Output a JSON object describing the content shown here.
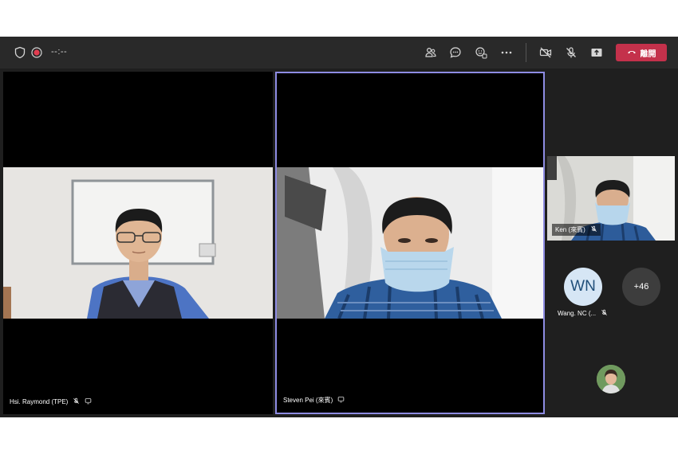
{
  "toolbar": {
    "timer": "--:--",
    "leave_label": "離開",
    "icons": {
      "shield": "shield-icon",
      "record": "record-icon",
      "people": "people-icon",
      "chat": "chat-icon",
      "reactions": "reactions-icon",
      "more": "more-options-icon",
      "camera": "camera-off-icon",
      "mic": "mic-off-icon",
      "share": "share-screen-icon",
      "leave": "hang-up-icon"
    },
    "colors": {
      "leave": "#c4314b",
      "record": "#e23d50"
    }
  },
  "participants": [
    {
      "name": "Hsi. Raymond (TPE)"
    },
    {
      "name": "Steven Pei (來賓)"
    },
    {
      "name": "Ken (來賓)"
    }
  ],
  "avatar": {
    "initials": "WN",
    "name": "Wang. NC (..."
  },
  "more_count": "+46",
  "colors": {
    "active_speaker_border": "#8e8ce3"
  }
}
